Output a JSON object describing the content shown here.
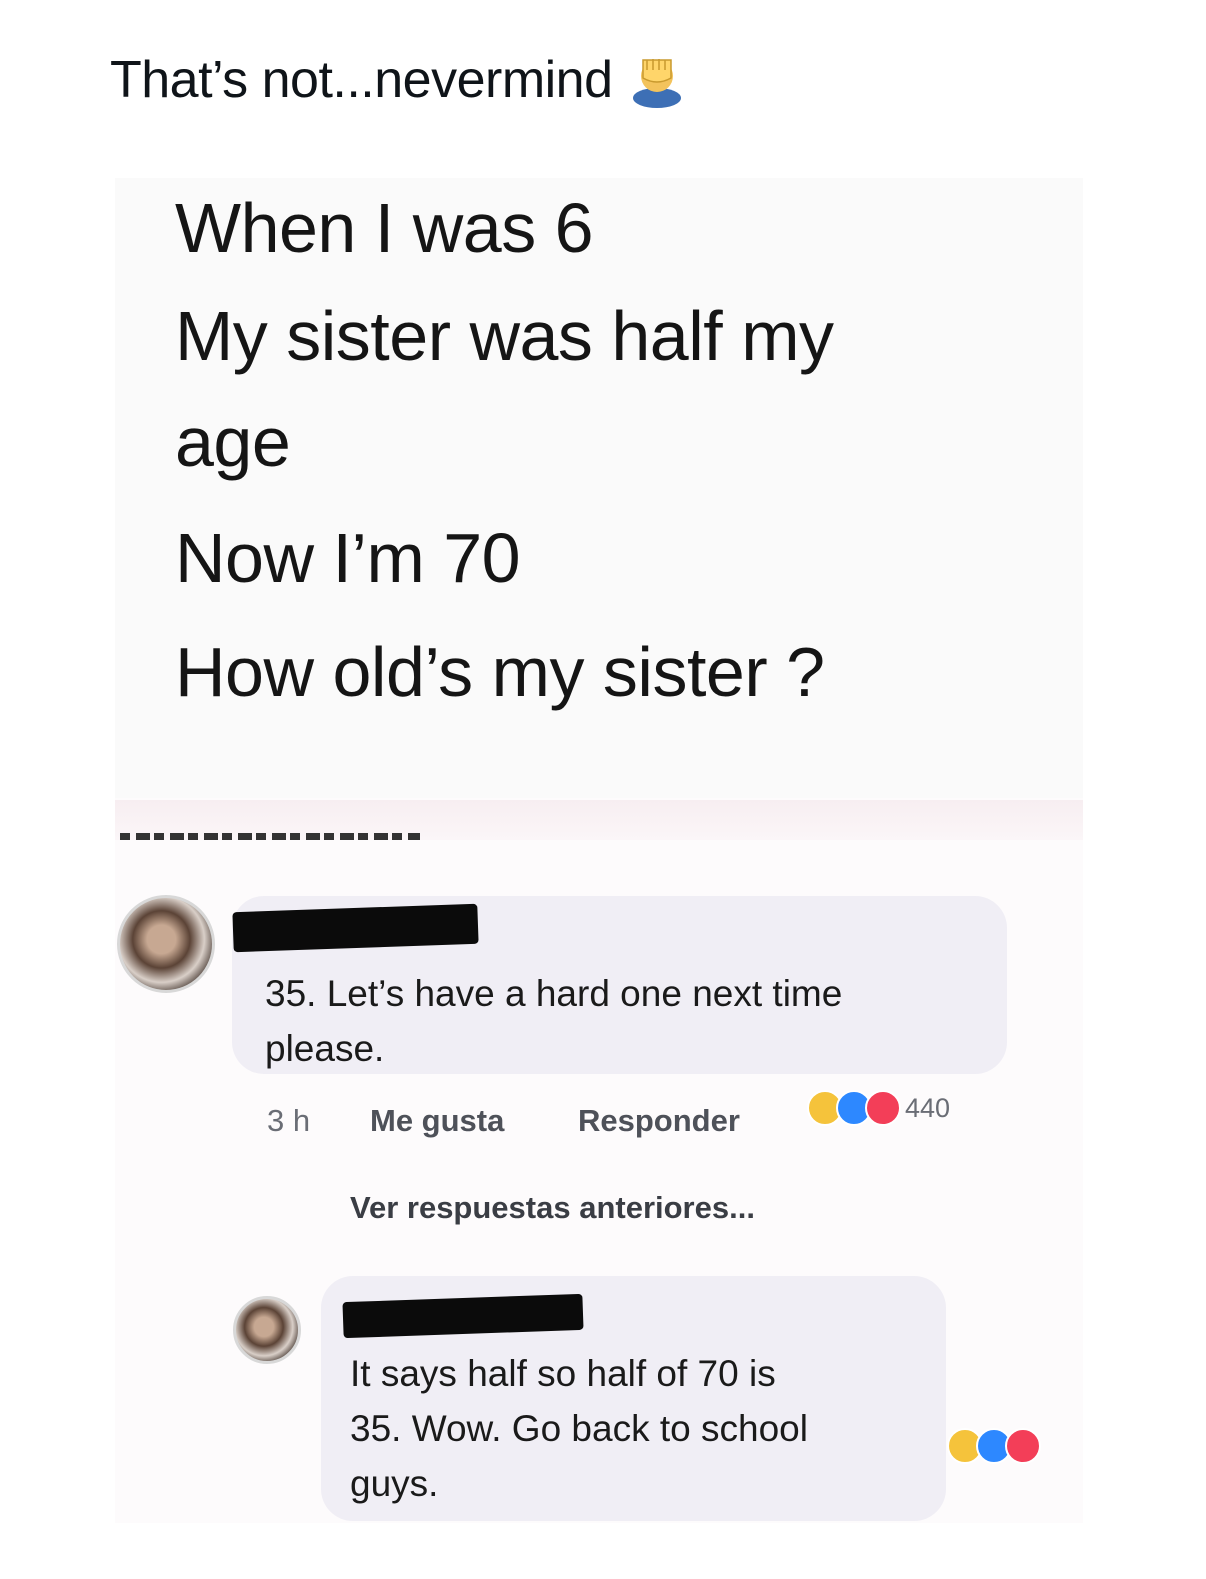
{
  "caption": {
    "text": "That’s not...nevermind",
    "emoji_icon": "facepalm-icon"
  },
  "question": {
    "lines": [
      "When I was 6",
      "My sister was half my",
      "age",
      "Now I’m 70",
      "How old’s my sister ?"
    ]
  },
  "comments": [
    {
      "text_lines": [
        "35. Let’s have a hard one next time",
        "please."
      ],
      "time": "3 h",
      "like_label": "Me gusta",
      "reply_label": "Responder",
      "reactions": [
        "haha",
        "like",
        "love"
      ],
      "reaction_count": "440"
    },
    {
      "text_lines": [
        "It says half so half of 70 is",
        "35. Wow. Go back to school",
        "guys."
      ],
      "reactions": [
        "haha",
        "like",
        "love"
      ]
    }
  ],
  "more_replies_label": "Ver respuestas anteriores...",
  "colors": {
    "haha": "#f5c33b",
    "like": "#2d88ff",
    "love": "#f33e58",
    "bubble": "#f0eef5"
  }
}
